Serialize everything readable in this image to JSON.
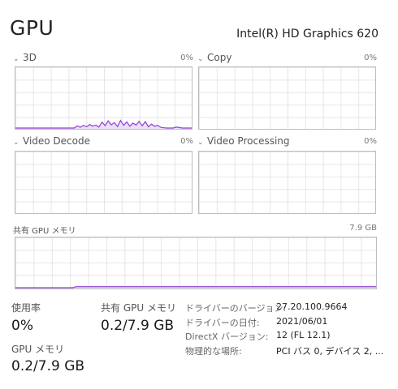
{
  "header": {
    "title": "GPU",
    "adapter": "Intel(R) HD Graphics 620"
  },
  "graphs": {
    "g3d": {
      "label": "3D",
      "value": "0%"
    },
    "copy": {
      "label": "Copy",
      "value": "0%"
    },
    "video_decode": {
      "label": "Video Decode",
      "value": "0%"
    },
    "video_processing": {
      "label": "Video Processing",
      "value": "0%"
    },
    "shared_memory": {
      "label": "共有 GPU メモリ",
      "value": "7.9 GB"
    }
  },
  "chart_data": [
    {
      "type": "area",
      "series": [
        {
          "values": [
            0,
            0,
            0,
            0,
            0,
            0,
            0,
            0,
            0,
            0,
            0,
            0,
            0,
            0,
            0,
            0,
            0,
            0,
            0,
            0,
            0.9,
            0.3,
            1.1,
            0.5,
            1.4,
            0.8,
            1.2,
            0.4,
            2.4,
            1.0,
            2.9,
            1.3,
            2.2,
            0.6,
            3.1,
            1.1,
            2.5,
            0.7,
            2.0,
            1.2,
            2.7,
            0.9,
            2.6,
            0.5,
            1.6,
            0.7,
            1.1,
            0.3,
            0.1,
            0,
            0,
            0,
            0.4,
            0.2,
            0,
            0,
            0,
            0
          ]
        }
      ],
      "ylim": [
        0,
        100
      ]
    },
    {
      "type": "area",
      "series": [
        {
          "values": [
            0,
            0,
            0,
            0,
            0,
            0,
            0,
            0,
            0,
            0,
            0,
            0,
            0,
            0,
            0,
            0,
            0,
            0,
            0,
            0,
            0,
            0,
            0,
            0,
            0,
            0,
            0,
            0,
            0,
            0,
            0,
            0,
            0,
            0,
            0,
            0,
            0,
            0,
            0,
            0,
            0,
            0,
            0,
            0,
            0,
            0,
            0,
            0,
            0,
            0,
            0,
            0,
            0,
            0,
            0,
            0,
            0,
            0,
            0,
            0,
            0,
            0,
            0,
            0,
            0,
            0,
            0,
            0,
            0,
            0,
            0,
            0,
            0,
            0,
            0,
            0,
            0,
            0,
            0,
            0,
            0,
            0,
            0,
            0,
            0,
            0,
            0,
            0,
            0,
            0,
            0,
            0,
            0,
            0,
            0,
            0,
            0,
            0,
            0,
            0,
            0,
            0,
            0,
            0,
            0,
            0,
            0,
            0,
            0,
            0,
            0,
            0,
            0,
            0,
            0,
            0,
            0,
            0,
            0,
            0
          ]
        },
        {
          "values": [
            0,
            0,
            0,
            0,
            0,
            0,
            0,
            0,
            0,
            0,
            0,
            0,
            0,
            0,
            0,
            0,
            0,
            0,
            0,
            0,
            0.2,
            0.2,
            0.2,
            0.2,
            0.2,
            0.2,
            0.2,
            0.2,
            0.2,
            0.2,
            0.2,
            0.2,
            0.2,
            0.2,
            0.2,
            0.2,
            0.2,
            0.2,
            0.2,
            0.2,
            0.2,
            0.2,
            0.2,
            0.2,
            0.2,
            0.2,
            0.2,
            0.2,
            0.2,
            0.2,
            0.2,
            0.2,
            0.2,
            0.2,
            0.2,
            0.2,
            0.2,
            0.2,
            0.2,
            0.2,
            0.2,
            0.2,
            0.2,
            0.2,
            0.2,
            0.2,
            0.2,
            0.2,
            0.2,
            0.2,
            0.2,
            0.2,
            0.2,
            0.2,
            0.2,
            0.2,
            0.2,
            0.2,
            0.2,
            0.2,
            0.2,
            0.2,
            0.2,
            0.2,
            0.2,
            0.2,
            0.2,
            0.2,
            0.2,
            0.2,
            0.2,
            0.2,
            0.2,
            0.2,
            0.2,
            0.2,
            0.2,
            0.2,
            0.2,
            0.2,
            0.2,
            0.2,
            0.2,
            0.2,
            0.2,
            0.2,
            0.2,
            0.2,
            0.2,
            0.2,
            0.2,
            0.2,
            0.2,
            0.2,
            0.2,
            0.2,
            0.2,
            0.2,
            0.2,
            0.2
          ]
        }
      ],
      "ylim": [
        0,
        7.9
      ]
    }
  ],
  "stats": {
    "utilization": {
      "label": "使用率",
      "value": "0%"
    },
    "gpu_memory": {
      "label": "GPU メモリ",
      "value": "0.2/7.9 GB"
    },
    "shared_gpu_memory": {
      "label": "共有 GPU メモリ",
      "value": "0.2/7.9 GB"
    }
  },
  "details": [
    {
      "key": "ドライバーのバージョン:",
      "value": "27.20.100.9664"
    },
    {
      "key": "ドライバーの日付:",
      "value": "2021/06/01"
    },
    {
      "key": "DirectX バージョン:",
      "value": "12 (FL 12.1)"
    },
    {
      "key": "物理的な場所:",
      "value": "PCI バス 0, デバイス 2, ..."
    }
  ],
  "colors": {
    "line": "#8f3ecf",
    "fill": "#ece0f7",
    "grid": "#d6d6d6",
    "border": "#bdbdbd"
  }
}
